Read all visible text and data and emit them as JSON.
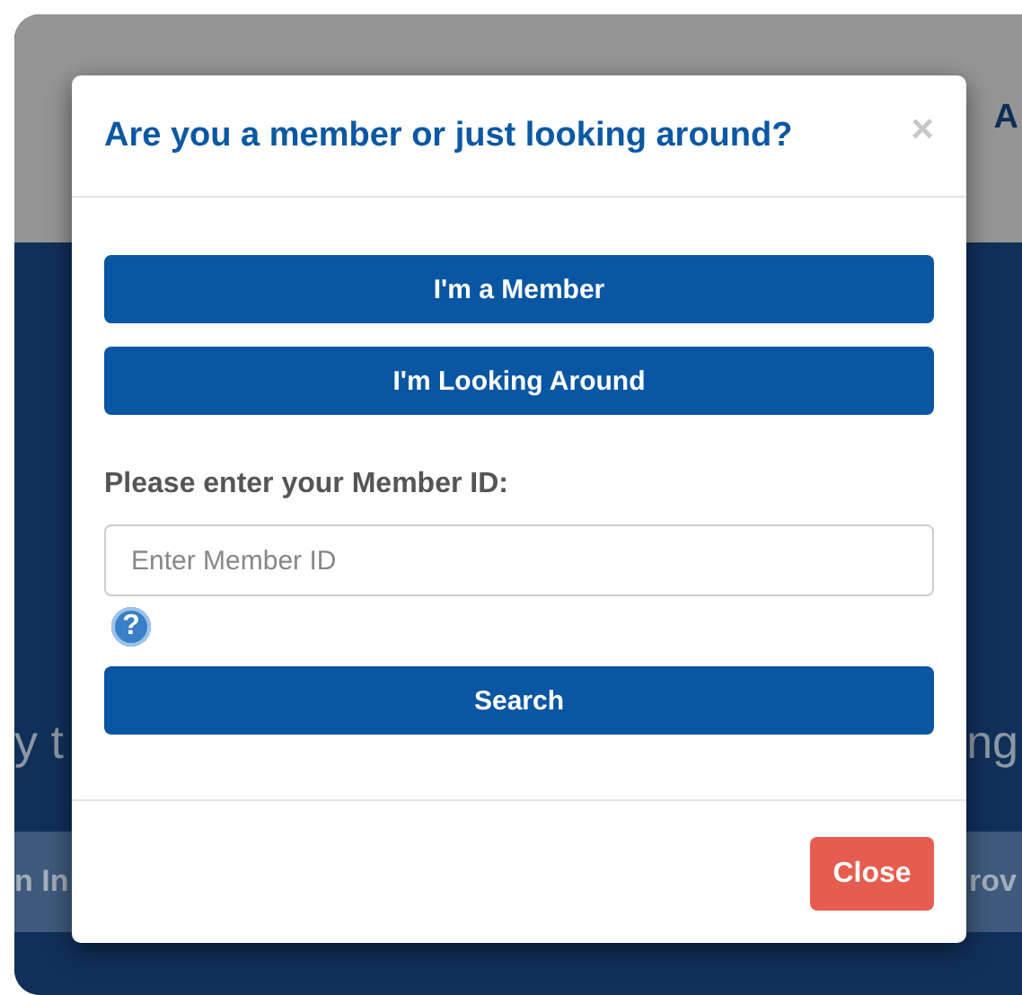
{
  "background": {
    "header_text": "A",
    "hero_left": "y t",
    "hero_right": "ng",
    "band_left": "n In",
    "band_right": "rov"
  },
  "modal": {
    "title": "Are you a member or just looking around?",
    "close_icon": "×",
    "choices": [
      {
        "label": "I'm a Member"
      },
      {
        "label": "I'm Looking Around"
      }
    ],
    "field_label": "Please enter your Member ID:",
    "placeholder": "Enter Member ID",
    "help_icon": "?",
    "search": "Search",
    "close": "Close"
  }
}
